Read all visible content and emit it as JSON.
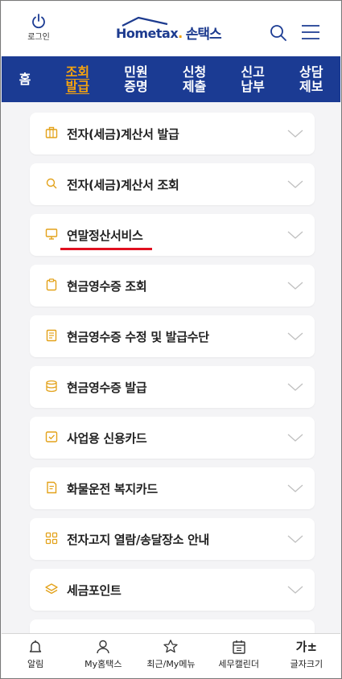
{
  "header": {
    "login_label": "로그인",
    "logo_home": "Home",
    "logo_tax": "tax",
    "logo_name": "손택스",
    "search_icon": "search-icon",
    "menu_icon": "hamburger-icon"
  },
  "nav": {
    "tabs": [
      {
        "label": "홈",
        "active": false
      },
      {
        "label": "조회\n발급",
        "active": true
      },
      {
        "label": "민원\n증명",
        "active": false
      },
      {
        "label": "신청\n제출",
        "active": false
      },
      {
        "label": "신고\n납부",
        "active": false
      },
      {
        "label": "상담\n제보",
        "active": false
      }
    ]
  },
  "menu_items": [
    {
      "label": "전자(세금)계산서 발급",
      "icon": "briefcase-icon"
    },
    {
      "label": "전자(세금)계산서 조회",
      "icon": "search-icon"
    },
    {
      "label": "연말정산서비스",
      "icon": "monitor-icon",
      "highlighted": true
    },
    {
      "label": "현금영수증 조회",
      "icon": "clipboard-icon"
    },
    {
      "label": "현금영수증 수정 및 발급수단",
      "icon": "document-icon"
    },
    {
      "label": "현금영수증 발급",
      "icon": "database-icon"
    },
    {
      "label": "사업용 신용카드",
      "icon": "checkbox-icon"
    },
    {
      "label": "화물운전 복지카드",
      "icon": "card-icon"
    },
    {
      "label": "전자고지 열람/송달장소 안내",
      "icon": "grid-icon"
    },
    {
      "label": "세금포인트",
      "icon": "layers-icon"
    }
  ],
  "bottom_bar": {
    "alarm": "알림",
    "my_hometax": "My홈택스",
    "recent": "최근/My메뉴",
    "calendar": "세무캘린더",
    "font_size_glyph": "가±",
    "font_size": "글자크기"
  },
  "colors": {
    "brand_blue": "#1b3b93",
    "accent_orange": "#f5a30f",
    "highlight_red": "#e01020",
    "background": "#f4f4f6"
  }
}
